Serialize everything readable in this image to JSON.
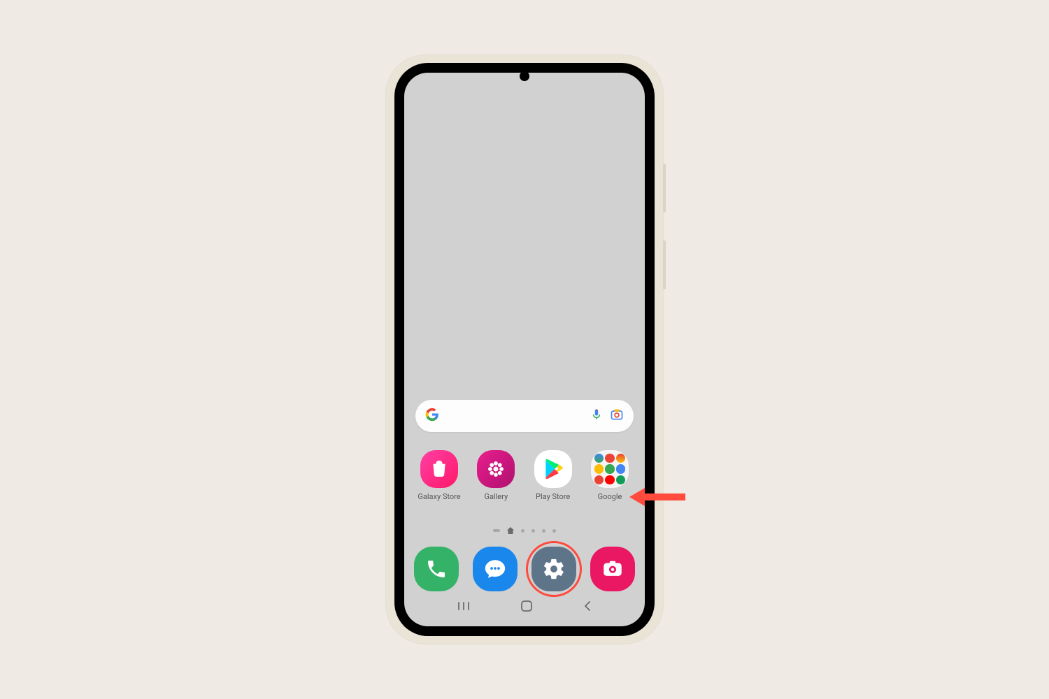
{
  "search": {
    "placeholder": ""
  },
  "apps": [
    {
      "name": "galaxy-store",
      "label": "Galaxy Store"
    },
    {
      "name": "gallery",
      "label": "Gallery"
    },
    {
      "name": "play-store",
      "label": "Play Store"
    },
    {
      "name": "google-folder",
      "label": "Google"
    }
  ],
  "dock": [
    {
      "name": "phone",
      "color": "#34b368"
    },
    {
      "name": "messages",
      "color": "#1a87ed"
    },
    {
      "name": "settings",
      "color": "#5e7488",
      "highlighted": true
    },
    {
      "name": "camera",
      "color": "#ea1763"
    }
  ],
  "annotation": {
    "target": "settings",
    "arrow_color": "#ff4a3d"
  }
}
